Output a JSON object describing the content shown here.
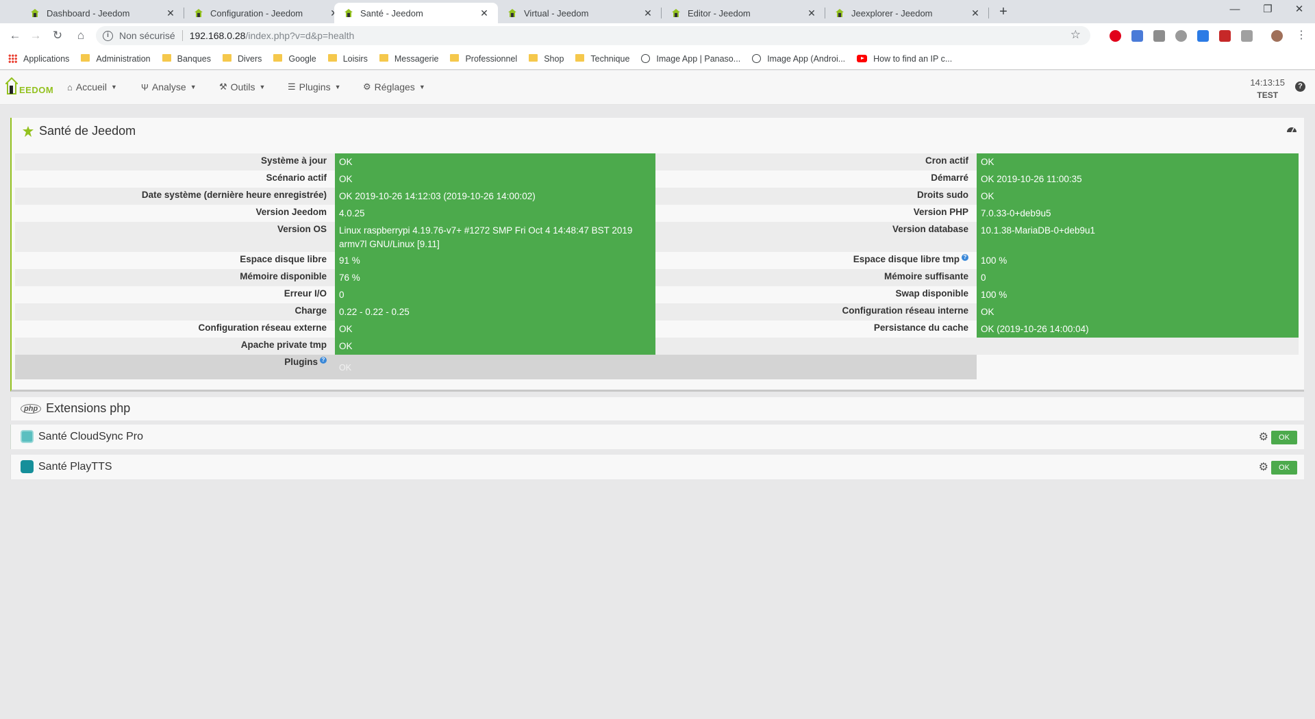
{
  "browser": {
    "tabs": [
      {
        "title": "Dashboard - Jeedom",
        "active": false
      },
      {
        "title": "Configuration - Jeedom",
        "active": false
      },
      {
        "title": "Santé - Jeedom",
        "active": true
      },
      {
        "title": "Virtual - Jeedom",
        "active": false
      },
      {
        "title": "Editor - Jeedom",
        "active": false
      },
      {
        "title": "Jeexplorer - Jeedom",
        "active": false
      }
    ],
    "address": {
      "security_label": "Non sécurisé",
      "host": "192.168.0.28",
      "path": "/index.php?v=d&p=health"
    },
    "bookmarks": [
      {
        "label": "Applications",
        "icon": "apps-grid-icon"
      },
      {
        "label": "Administration",
        "icon": "folder-icon"
      },
      {
        "label": "Banques",
        "icon": "folder-icon"
      },
      {
        "label": "Divers",
        "icon": "folder-icon"
      },
      {
        "label": "Google",
        "icon": "folder-icon"
      },
      {
        "label": "Loisirs",
        "icon": "folder-icon"
      },
      {
        "label": "Messagerie",
        "icon": "folder-icon"
      },
      {
        "label": "Professionnel",
        "icon": "folder-icon"
      },
      {
        "label": "Shop",
        "icon": "folder-icon"
      },
      {
        "label": "Technique",
        "icon": "folder-icon"
      },
      {
        "label": "Image App | Panaso...",
        "icon": "globe-icon"
      },
      {
        "label": "Image App (Androi...",
        "icon": "globe-icon"
      },
      {
        "label": "How to find an IP c...",
        "icon": "youtube-icon"
      }
    ]
  },
  "app": {
    "logo_text": "EEDOM",
    "menu": [
      {
        "label": "Accueil",
        "icon": "home-icon"
      },
      {
        "label": "Analyse",
        "icon": "stethoscope-icon"
      },
      {
        "label": "Outils",
        "icon": "wrench-icon"
      },
      {
        "label": "Plugins",
        "icon": "list-icon"
      },
      {
        "label": "Réglages",
        "icon": "gear-icon"
      }
    ],
    "clock": {
      "time": "14:13:15",
      "name": "TEST"
    }
  },
  "health": {
    "title": "Santé de Jeedom",
    "left": [
      {
        "label": "Système à jour",
        "value": "OK"
      },
      {
        "label": "Scénario actif",
        "value": "OK"
      },
      {
        "label": "Date système (dernière heure enregistrée)",
        "value": "OK 2019-10-26 14:12:03 (2019-10-26 14:00:02)"
      },
      {
        "label": "Version Jeedom",
        "value": "4.0.25"
      },
      {
        "label": "Version OS",
        "value": "Linux raspberrypi 4.19.76-v7+ #1272 SMP Fri Oct 4 14:48:47 BST 2019 armv7l GNU/Linux [9.11]"
      },
      {
        "label": "Espace disque libre",
        "value": "91 %"
      },
      {
        "label": "Mémoire disponible",
        "value": "76 %"
      },
      {
        "label": "Erreur I/O",
        "value": "0"
      },
      {
        "label": "Charge",
        "value": "0.22 - 0.22 - 0.25"
      },
      {
        "label": "Configuration réseau externe",
        "value": "OK"
      },
      {
        "label": "Apache private tmp",
        "value": "OK"
      }
    ],
    "right": [
      {
        "label": "Cron actif",
        "value": "OK"
      },
      {
        "label": "Démarré",
        "value": "OK 2019-10-26 11:00:35"
      },
      {
        "label": "Droits sudo",
        "value": "OK"
      },
      {
        "label": "Version PHP",
        "value": "7.0.33-0+deb9u5"
      },
      {
        "label": "Version database",
        "value": "10.1.38-MariaDB-0+deb9u1"
      },
      {
        "label": "Espace disque libre tmp",
        "value": "100 %"
      },
      {
        "label": "Mémoire suffisante",
        "value": "0"
      },
      {
        "label": "Swap disponible",
        "value": "100 %"
      },
      {
        "label": "Configuration réseau interne",
        "value": "OK"
      },
      {
        "label": "Persistance du cache",
        "value": "OK (2019-10-26 14:00:04)"
      }
    ],
    "plugins": {
      "label": "Plugins",
      "value": "OK"
    }
  },
  "sections": {
    "php": {
      "title": "Extensions php",
      "badge": "php"
    },
    "cloudsync": {
      "title": "Santé CloudSync Pro",
      "status": "OK"
    },
    "playtts": {
      "title": "Santé PlayTTS",
      "status": "OK"
    }
  },
  "colors": {
    "ok_green": "#4caa4c",
    "jeedom_green": "#93c11f"
  }
}
